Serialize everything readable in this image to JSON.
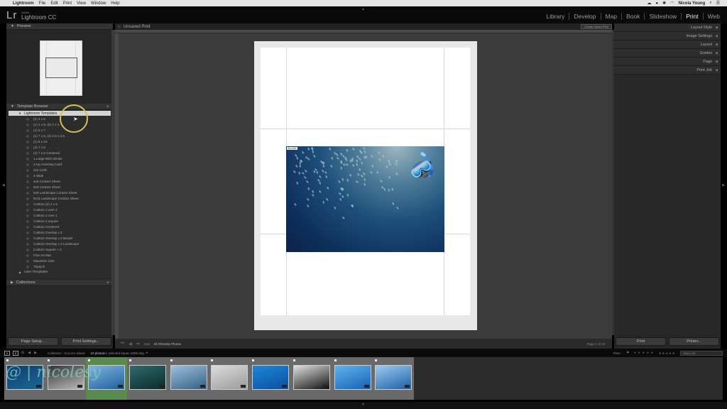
{
  "menubar": {
    "app": "Lightroom",
    "items": [
      "File",
      "Edit",
      "Print",
      "View",
      "Window",
      "Help"
    ],
    "user": "Nicola Young"
  },
  "identity": {
    "logo": "Lr",
    "vendor": "Adobe",
    "product": "Lightroom CC"
  },
  "modules": [
    {
      "label": "Library",
      "active": false
    },
    {
      "label": "Develop",
      "active": false
    },
    {
      "label": "Map",
      "active": false
    },
    {
      "label": "Book",
      "active": false
    },
    {
      "label": "Slideshow",
      "active": false
    },
    {
      "label": "Print",
      "active": true
    },
    {
      "label": "Web",
      "active": false
    }
  ],
  "left_panel": {
    "preview_title": "Preview",
    "template_browser_title": "Template Browser",
    "folder": "Lightroom Templates",
    "templates": [
      "(1) 4 x 6",
      "(1) 4 x 6, (6) 2 x 3",
      "(1) 5 x 7",
      "(1) 7 x 5, (4) 2.5 x 3.5",
      "(1) 8 x 10",
      "(2) 7 x 5",
      "(2) 7 x 5 Centered",
      "1 Large With Stroke",
      "2-Up Greeting Card",
      "2x2 Cells",
      "4 Wide",
      "4x5 Contact Sheet",
      "5x8 Contact Sheet",
      "5x9 Landscape Contact Sheet",
      "5x11 Landscape Contact Sheet",
      "Custom (2) 4 x 6",
      "Custom 1 over 2",
      "Custom 2 over 1",
      "Custom 4 square",
      "Custom Centered",
      "Custom Overlap x 3",
      "Custom Overlap x 3 Border",
      "Custom Overlap x 3 Landscape",
      "Custom Square + 2",
      "Fine Art Mat",
      "Maximize Size",
      "Triptych"
    ],
    "user_templates": "User Templates",
    "collections_title": "Collections",
    "page_setup": "Page Setup...",
    "print_settings": "Print Settings..."
  },
  "center": {
    "title": "Unsaved Print",
    "create_saved_print": "Create Saved Print",
    "photo_label": "6 x 4 in",
    "use_label": "Use:",
    "use_value": "All Filmstrip Photos",
    "page_count": "Page 1 of 10"
  },
  "right_panel": {
    "sections": [
      "Layout Style",
      "Image Settings",
      "Layout",
      "Guides",
      "Page",
      "Print Job"
    ],
    "print": "Print",
    "printer": "Printer..."
  },
  "filmstrip": {
    "page1": "1",
    "page2": "2",
    "collection": "Collection : Socorro Island",
    "count": "10 photos",
    "selected": " /1 selected /tupan 2595.dng",
    "filter_label": "Filter :",
    "filter_value": "Filters Off",
    "watermark": "@ | nicolesy",
    "thumbs": [
      {
        "selected": false,
        "colors": [
          "#0e3e6e",
          "#1c6795"
        ]
      },
      {
        "selected": false,
        "colors": [
          "#333",
          "#bdbdbd"
        ]
      },
      {
        "selected": true,
        "colors": [
          "#7fb5dc",
          "#1f5f9f"
        ]
      },
      {
        "selected": false,
        "colors": [
          "#2f6b6b",
          "#0b2a2c"
        ]
      },
      {
        "selected": false,
        "colors": [
          "#9cc0dc",
          "#345f83"
        ]
      },
      {
        "selected": false,
        "colors": [
          "#dcdcdc",
          "#9a9a9a"
        ]
      },
      {
        "selected": false,
        "colors": [
          "#1e86d6",
          "#0c4fa0"
        ]
      },
      {
        "selected": false,
        "colors": [
          "#e0e0e0",
          "#111"
        ]
      },
      {
        "selected": false,
        "colors": [
          "#5fb3ec",
          "#1562b8"
        ]
      },
      {
        "selected": false,
        "colors": [
          "#9ccbee",
          "#1e5fa8"
        ]
      }
    ]
  }
}
